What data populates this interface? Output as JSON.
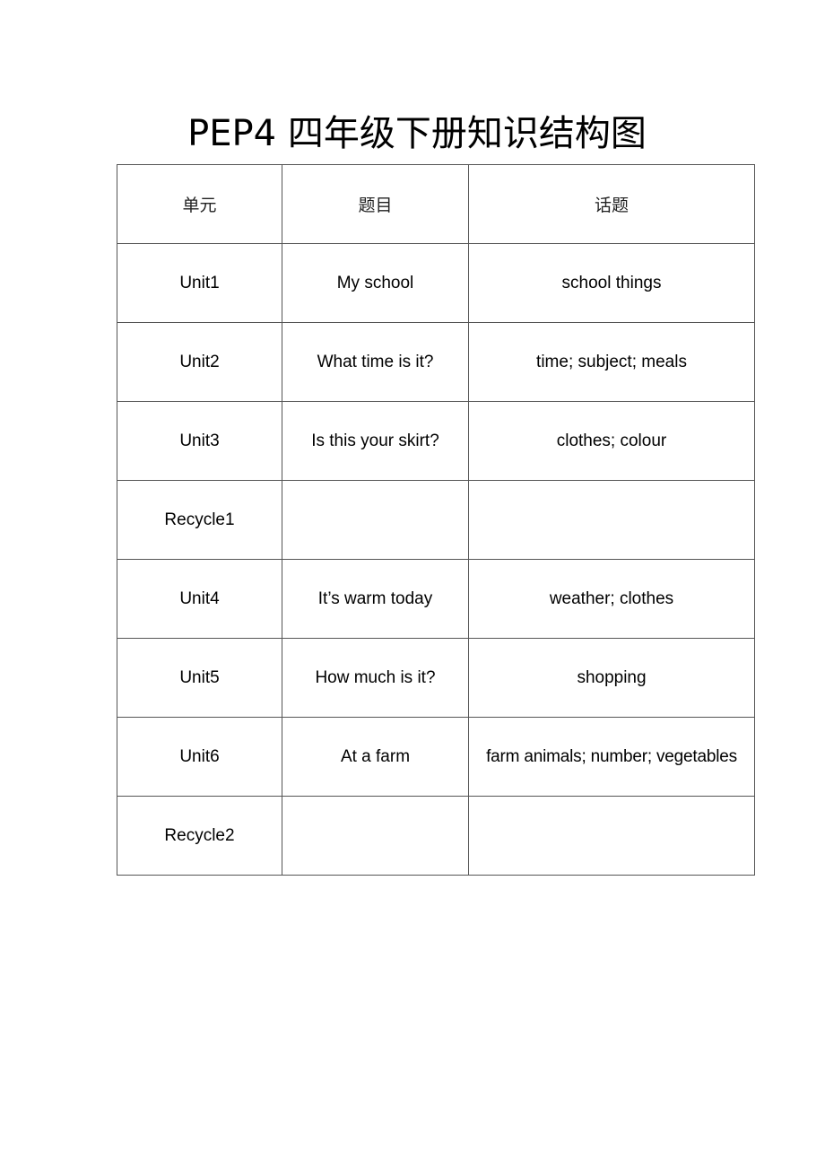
{
  "document": {
    "title": "PEP4 四年级下册知识结构图"
  },
  "table": {
    "headers": [
      "单元",
      "题目",
      "话题"
    ],
    "rows": [
      {
        "unit": "Unit1",
        "title": "My school",
        "topic": "school things"
      },
      {
        "unit": "Unit2",
        "title": "What time is it?",
        "topic": "time; subject; meals"
      },
      {
        "unit": "Unit3",
        "title": "Is this your skirt?",
        "topic": "clothes; colour"
      },
      {
        "unit": "Recycle1",
        "title": "",
        "topic": ""
      },
      {
        "unit": "Unit4",
        "title": "It’s warm today",
        "topic": "weather; clothes"
      },
      {
        "unit": "Unit5",
        "title": "How much is it?",
        "topic": "shopping"
      },
      {
        "unit": "Unit6",
        "title": "At a farm",
        "topic": "farm animals; number; vegetables"
      },
      {
        "unit": "Recycle2",
        "title": "",
        "topic": ""
      }
    ]
  }
}
